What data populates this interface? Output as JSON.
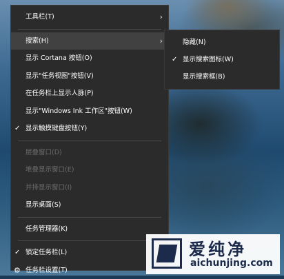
{
  "main_menu": {
    "items": [
      {
        "label": "工具栏(T)",
        "submenu": true,
        "icon": "chevron-right-icon"
      },
      {
        "label": "搜索(H)",
        "submenu": true,
        "icon": "chevron-right-icon",
        "highlighted": true
      },
      {
        "label": "显示 Cortana 按钮(O)"
      },
      {
        "label": "显示\"任务视图\"按钮(V)"
      },
      {
        "label": "在任务栏上显示人脉(P)"
      },
      {
        "label": "显示\"Windows Ink 工作区\"按钮(W)"
      },
      {
        "label": "显示触摸键盘按钮(Y)",
        "checked": true,
        "icon": "checkmark-icon"
      },
      {
        "label": "层叠窗口(D)",
        "disabled": true
      },
      {
        "label": "堆叠显示窗口(E)",
        "disabled": true
      },
      {
        "label": "并排显示窗口(I)",
        "disabled": true
      },
      {
        "label": "显示桌面(S)"
      },
      {
        "label": "任务管理器(K)"
      },
      {
        "label": "锁定任务栏(L)",
        "checked": true,
        "icon": "checkmark-icon"
      },
      {
        "label": "任务栏设置(T)",
        "icon": "gear-icon"
      }
    ]
  },
  "sub_menu": {
    "items": [
      {
        "label": "隐藏(N)"
      },
      {
        "label": "显示搜索图标(W)",
        "checked": true,
        "icon": "checkmark-icon"
      },
      {
        "label": "显示搜索框(B)"
      }
    ]
  },
  "watermark": {
    "title": "爱纯净",
    "url": "aichunjing.com"
  },
  "colors": {
    "menu_bg": "#2b2b2b",
    "menu_highlight": "#414141",
    "menu_text": "#ffffff",
    "menu_disabled": "#6d6d6d",
    "separator": "#4a4a4a",
    "watermark_text": "#1c2b4c"
  }
}
